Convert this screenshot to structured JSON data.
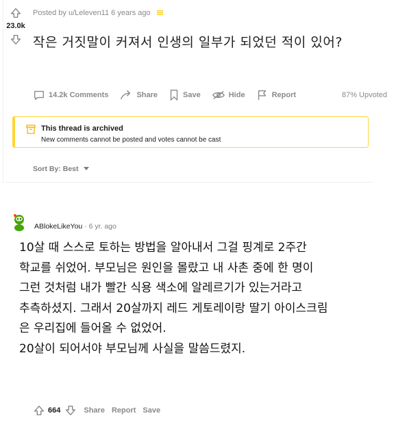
{
  "post": {
    "score": "23.0k",
    "posted_by": "Posted by u/Leleven11 6 years ago",
    "title": "작은 거짓말이 커져서 인생의 일부가 되었던 적이 있어?",
    "actions": {
      "comments": "14.2k Comments",
      "share": "Share",
      "save": "Save",
      "hide": "Hide",
      "report": "Report"
    },
    "upvoted": "87% Upvoted"
  },
  "archived": {
    "heading": "This thread is archived",
    "subtext": "New comments cannot be posted and votes cannot be cast"
  },
  "sort": {
    "label": "Sort By: Best"
  },
  "comment": {
    "username": "ABlokeLikeYou",
    "time": " · 6 yr. ago",
    "lines": [
      "10살 때 스스로 토하는 방법을 알아내서 그걸 핑계로 2주간",
      "학교를 쉬었어. 부모님은 원인을 몰랐고 내 사촌 중에 한 명이",
      "그런 것처럼 내가 빨간 식용 색소에 알레르기가 있는거라고",
      "추측하셨지. 그래서 20살까지 레드 게토레이랑 딸기 아이스크림",
      "은 우리집에 들어올 수 없었어.",
      "20살이 되어서야 부모님께 사실을 말씀드렸지."
    ],
    "score": "664",
    "share": "Share",
    "report": "Report",
    "save": "Save"
  },
  "colors": {
    "accent_yellow": "#ffd635",
    "meta_gray": "#878a8c",
    "avatar_green": "#46a508"
  }
}
